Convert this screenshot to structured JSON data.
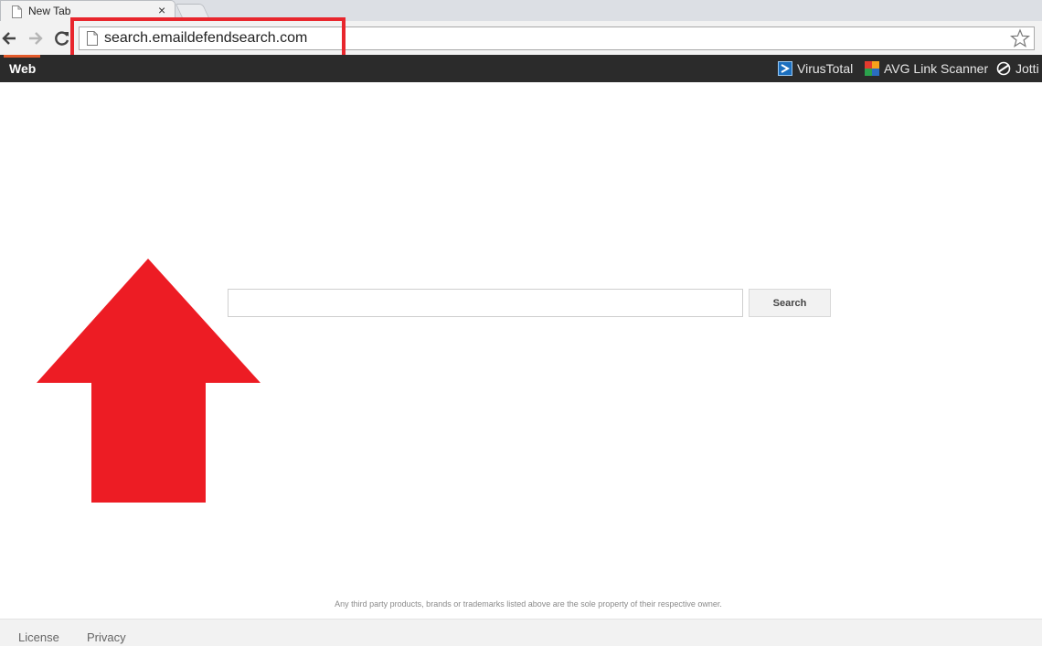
{
  "browser": {
    "tab": {
      "title": "New Tab",
      "close_glyph": "×"
    },
    "address_bar": {
      "url": "search.emaildefendsearch.com"
    },
    "icons": [
      "page-icon",
      "back-arrow-icon",
      "forward-arrow-icon",
      "reload-icon",
      "bookmark-star-icon",
      "close-icon"
    ]
  },
  "navbar": {
    "active_tab": "Web",
    "scanners": [
      {
        "label": "VirusTotal",
        "icon": "virustotal-icon"
      },
      {
        "label": "AVG Link Scanner",
        "icon": "avg-icon"
      },
      {
        "label": "Jotti",
        "icon": "jotti-icon"
      }
    ]
  },
  "search": {
    "input_value": "",
    "button_label": "Search"
  },
  "annotations": {
    "highlight_color": "#e8262d",
    "arrow_color": "#ed1c24"
  },
  "disclaimer": "Any third party products, brands or trademarks listed above are the sole property of their respective owner.",
  "footer": {
    "links": [
      "License",
      "Privacy"
    ]
  },
  "colors": {
    "navbar_bg": "#2b2b2b",
    "active_tab_accent": "#e25a2b"
  }
}
